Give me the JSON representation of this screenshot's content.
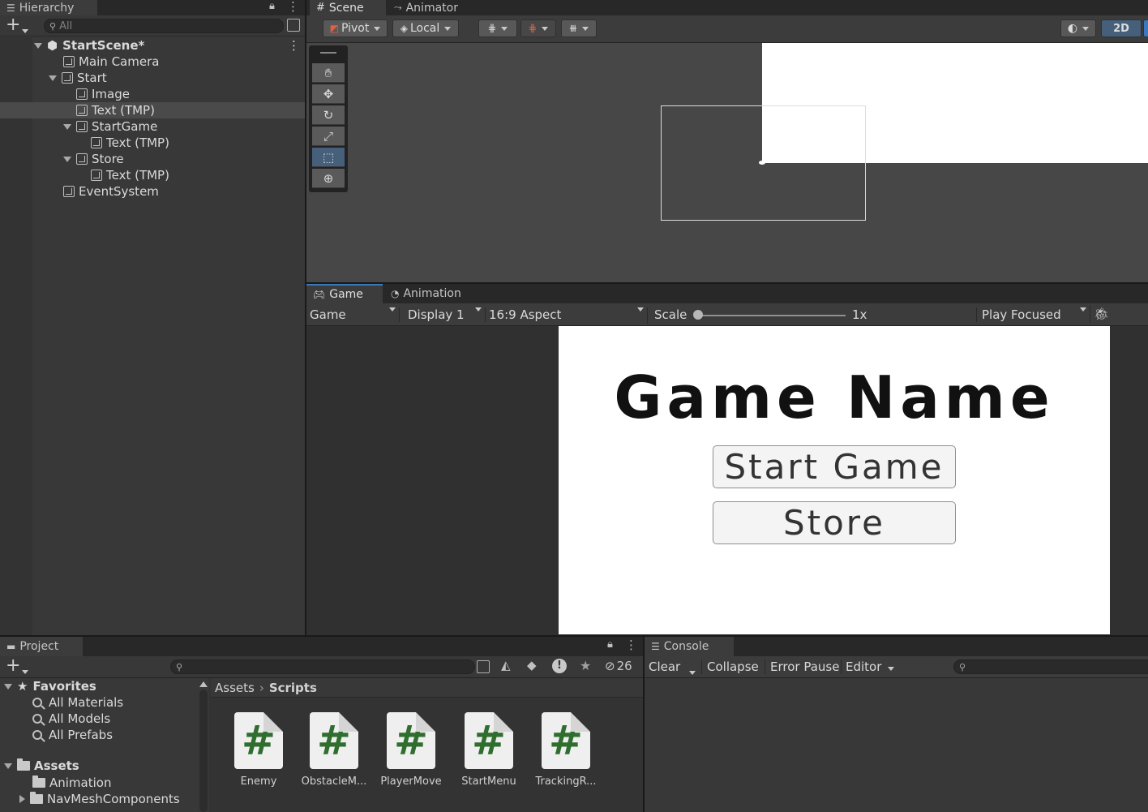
{
  "hierarchy": {
    "tab_label": "Hierarchy",
    "search_placeholder": "All",
    "scene_name": "StartScene*",
    "items": [
      {
        "label": "Main Camera"
      },
      {
        "label": "Start"
      },
      {
        "label": "Image"
      },
      {
        "label": "Text (TMP)"
      },
      {
        "label": "StartGame"
      },
      {
        "label": "Text (TMP)"
      },
      {
        "label": "Store"
      },
      {
        "label": "Text (TMP)"
      },
      {
        "label": "EventSystem"
      }
    ]
  },
  "scene": {
    "tabs": [
      "Scene",
      "Animator"
    ],
    "pivot_label": "Pivot",
    "local_label": "Local",
    "mode_2d_label": "2D"
  },
  "game": {
    "tabs": [
      "Game",
      "Animation"
    ],
    "view_dropdown": "Game",
    "display_dropdown": "Display 1",
    "aspect_dropdown": "16:9 Aspect",
    "scale_label": "Scale",
    "scale_value": "1x",
    "scale_fraction": 0.0,
    "play_mode_dropdown": "Play Focused",
    "title_text": "Game Name",
    "start_button_label": "Start Game",
    "store_button_label": "Store"
  },
  "project": {
    "tab_label": "Project",
    "hidden_count": "26",
    "favorites_label": "Favorites",
    "favorites": [
      "All Materials",
      "All Models",
      "All Prefabs"
    ],
    "assets_label": "Assets",
    "asset_folders": [
      "Animation",
      "NavMeshComponents"
    ],
    "breadcrumb_root": "Assets",
    "breadcrumb_current": "Scripts",
    "scripts": [
      "Enemy",
      "ObstacleM...",
      "PlayerMove",
      "StartMenu",
      "TrackingR..."
    ]
  },
  "console": {
    "tab_label": "Console",
    "clear_label": "Clear",
    "collapse_label": "Collapse",
    "error_pause_label": "Error Pause",
    "editor_label": "Editor"
  },
  "colors": {
    "accent": "#3a79bb",
    "panel": "#383838",
    "script_hash": "#2f6e2f"
  }
}
